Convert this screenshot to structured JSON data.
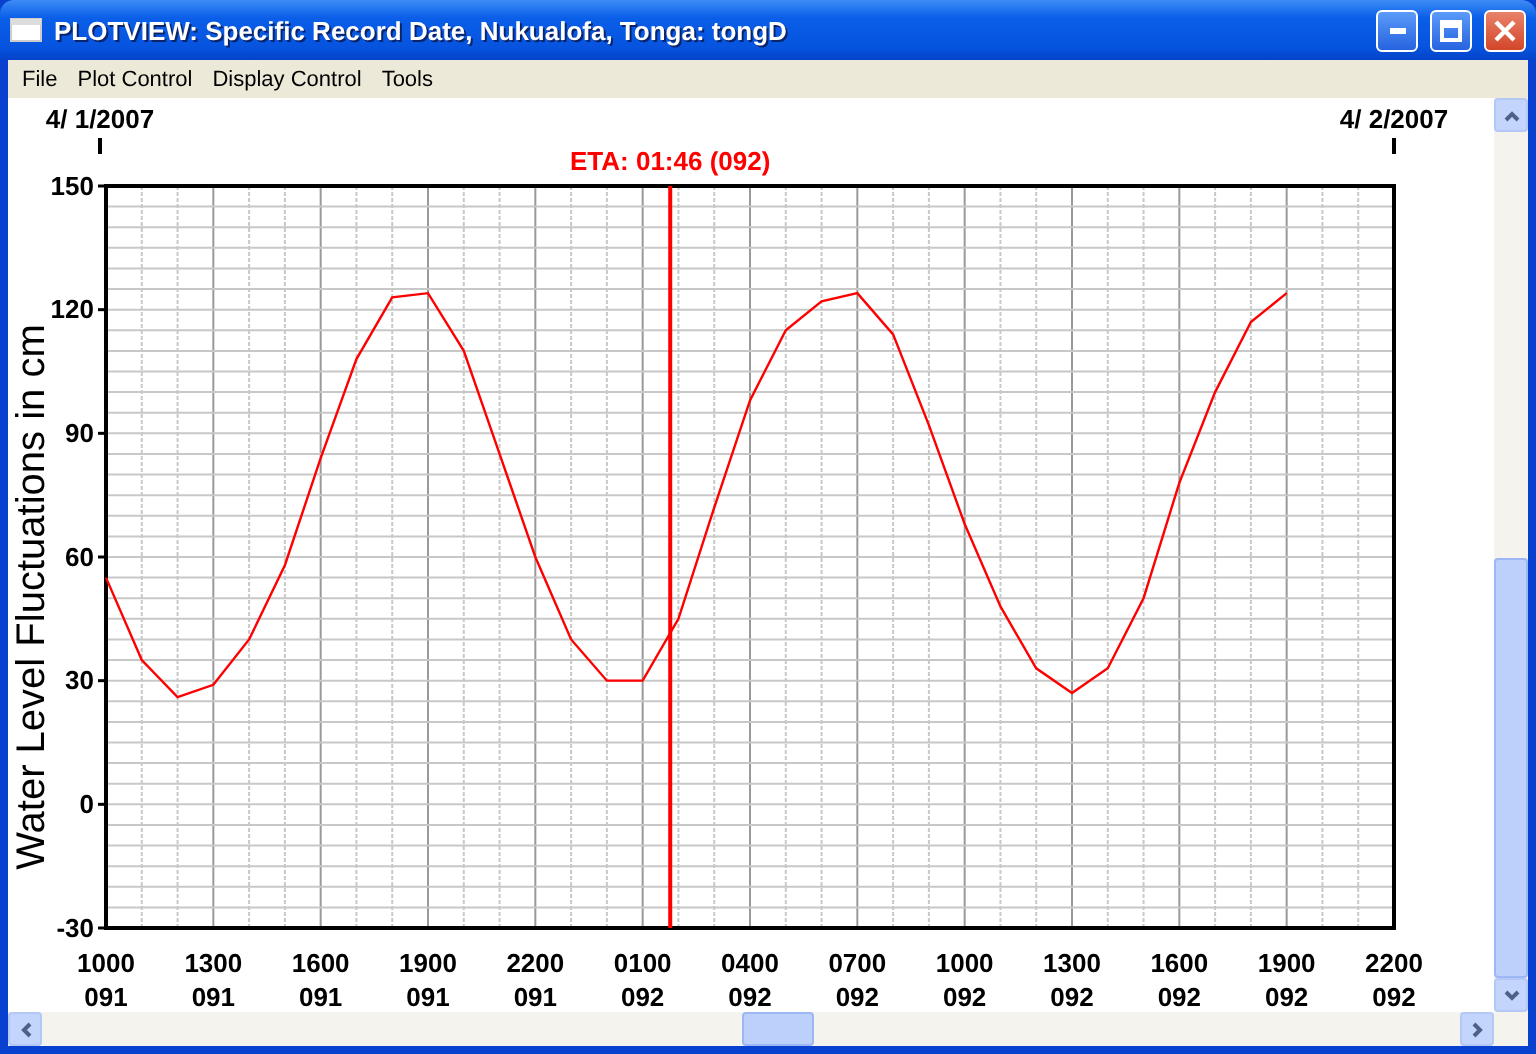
{
  "window": {
    "title": "PLOTVIEW: Specific Record Date, Nukualofa, Tonga: tongD"
  },
  "menu": [
    "File",
    "Plot Control",
    "Display Control",
    "Tools"
  ],
  "plot": {
    "dates": [
      "4/ 1/2007",
      "4/ 2/2007"
    ],
    "chart_data": {
      "type": "line",
      "ylabel": "Water Level Fluctuations in cm",
      "categories": [
        "1000 091",
        null,
        null,
        "1300 091",
        null,
        null,
        "1600 091",
        null,
        null,
        "1900 091",
        null,
        null,
        "2200 091",
        null,
        null,
        "0100 092",
        null,
        null,
        "0400 092",
        null,
        null,
        "0700 092",
        null,
        null,
        "1000 092",
        null,
        null,
        "1300 092",
        null,
        null,
        "1600 092",
        null,
        null,
        "1900 092",
        null,
        null,
        "2200 092"
      ],
      "series": [
        {
          "color": "#ff0000",
          "values": [
            55,
            35,
            26,
            29,
            40,
            58,
            84,
            108,
            123,
            124,
            110,
            85,
            60,
            40,
            30,
            30,
            45,
            72,
            98,
            115,
            122,
            124,
            114,
            92,
            68,
            48,
            33,
            27,
            33,
            50,
            78,
            100,
            117,
            124,
            null,
            null,
            null
          ]
        }
      ],
      "ylim": [
        -30,
        150
      ],
      "grid": true,
      "yticks": [
        -30,
        0,
        30,
        60,
        90,
        120,
        150
      ],
      "annotations": [
        "ETA: 01:46 (092)"
      ]
    }
  }
}
